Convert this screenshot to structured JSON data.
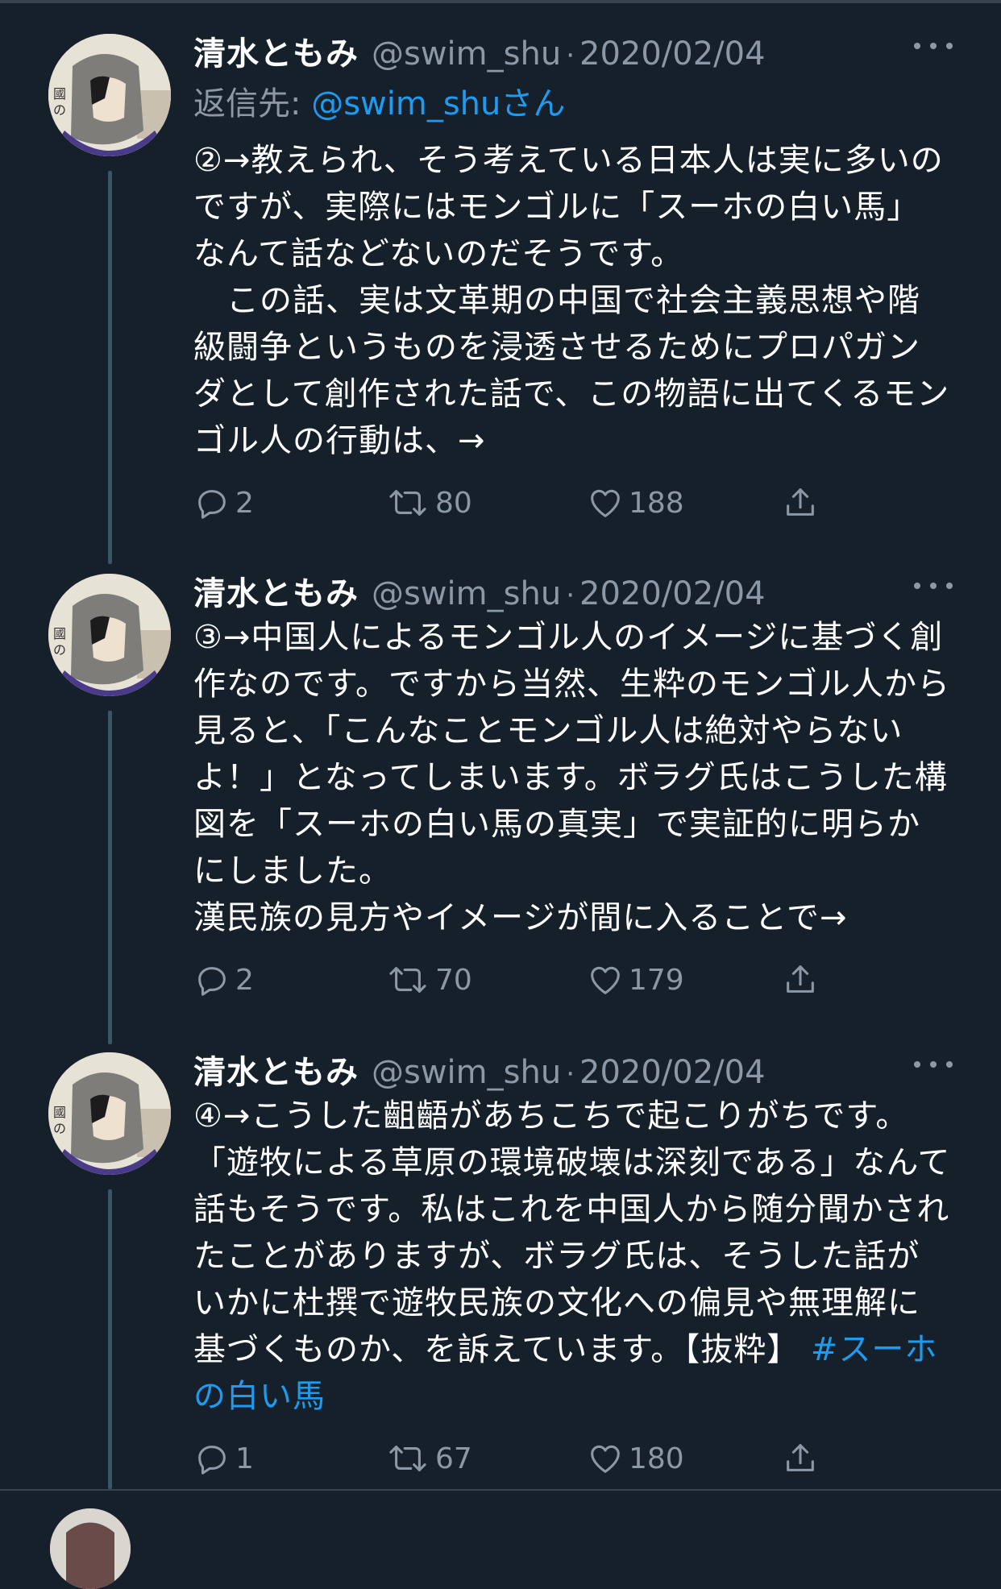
{
  "tweets": [
    {
      "display_name": "清水ともみ",
      "handle": "@swim_shu",
      "separator": "·",
      "date": "2020/02/04",
      "reply_to_label": "返信先: ",
      "reply_to_mention": "@swim_shuさん",
      "text": "②→教えられ、そう考えている日本人は実に多いのですが、実際にはモンゴルに「スーホの白い馬」なんて話などないのだそうです。\n　この話、実は文革期の中国で社会主義思想や階級闘争というものを浸透させるためにプロパガンダとして創作された話で、この物語に出てくるモンゴル人の行動は、→",
      "hashtag": "",
      "replies": "2",
      "retweets": "80",
      "likes": "188"
    },
    {
      "display_name": "清水ともみ",
      "handle": "@swim_shu",
      "separator": "·",
      "date": "2020/02/04",
      "text": "③→中国人によるモンゴル人のイメージに基づく創作なのです。ですから当然、生粋のモンゴル人から見ると、「こんなことモンゴル人は絶対やらないよ！」となってしまいます。ボラグ氏はこうした構図を「スーホの白い馬の真実」で実証的に明らかにしました。\n漢民族の見方やイメージが間に入ることで→",
      "hashtag": "",
      "replies": "2",
      "retweets": "70",
      "likes": "179"
    },
    {
      "display_name": "清水ともみ",
      "handle": "@swim_shu",
      "separator": "·",
      "date": "2020/02/04",
      "text": "④→こうした齟齬があちこちで起こりがちです。「遊牧による草原の環境破壊は深刻である」なんて話もそうです。私はこれを中国人から随分聞かされたことがありますが、ボラグ氏は、そうした話がいかに杜撰で遊牧民族の文化への偏見や無理解に基づくものか、を訴えています。【抜粋】",
      "hashtag": "#スーホの白い馬",
      "replies": "1",
      "retweets": "67",
      "likes": "180"
    }
  ],
  "colors": {
    "background": "#15202b",
    "text_primary": "#ffffff",
    "text_secondary": "#8b98a5",
    "accent": "#1d9bf0",
    "thread_line": "#3d5466"
  },
  "icons": [
    "reply-icon",
    "retweet-icon",
    "like-icon",
    "share-icon",
    "more-icon"
  ]
}
